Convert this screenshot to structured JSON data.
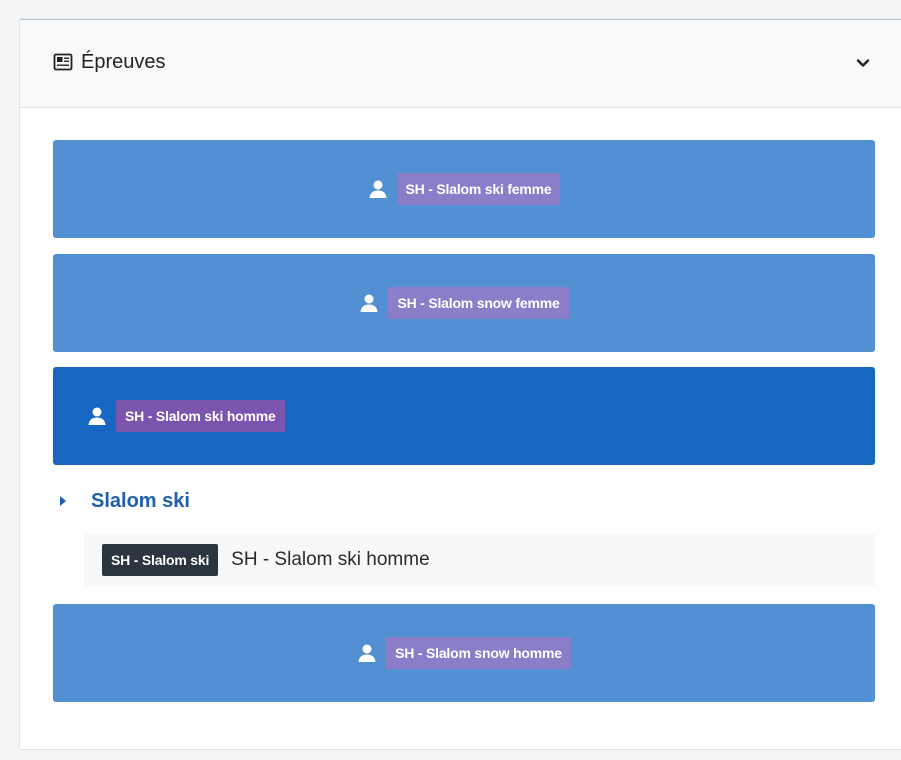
{
  "panel": {
    "title": "Épreuves",
    "title_icon": "newspaper-icon",
    "toggle_icon": "chevron-down-icon"
  },
  "events": [
    {
      "label": "SH - Slalom ski femme",
      "icon": "user-icon",
      "active": false
    },
    {
      "label": "SH - Slalom snow femme",
      "icon": "user-icon",
      "active": false
    },
    {
      "label": "SH - Slalom ski homme",
      "icon": "user-icon",
      "active": true
    },
    {
      "label": "SH - Slalom snow homme",
      "icon": "user-icon",
      "active": false
    }
  ],
  "expanded_group": {
    "label": "Slalom ski",
    "icon": "caret-right-icon",
    "item": {
      "badge": "SH - Slalom ski",
      "text": "SH - Slalom ski homme"
    }
  },
  "colors": {
    "card": "#528fd3",
    "card_active": "#1666c2",
    "badge": "#8c7dc8",
    "badge_active": "#7a54ad",
    "group_label": "#1f5fb2",
    "sub_badge": "#2a3540"
  }
}
